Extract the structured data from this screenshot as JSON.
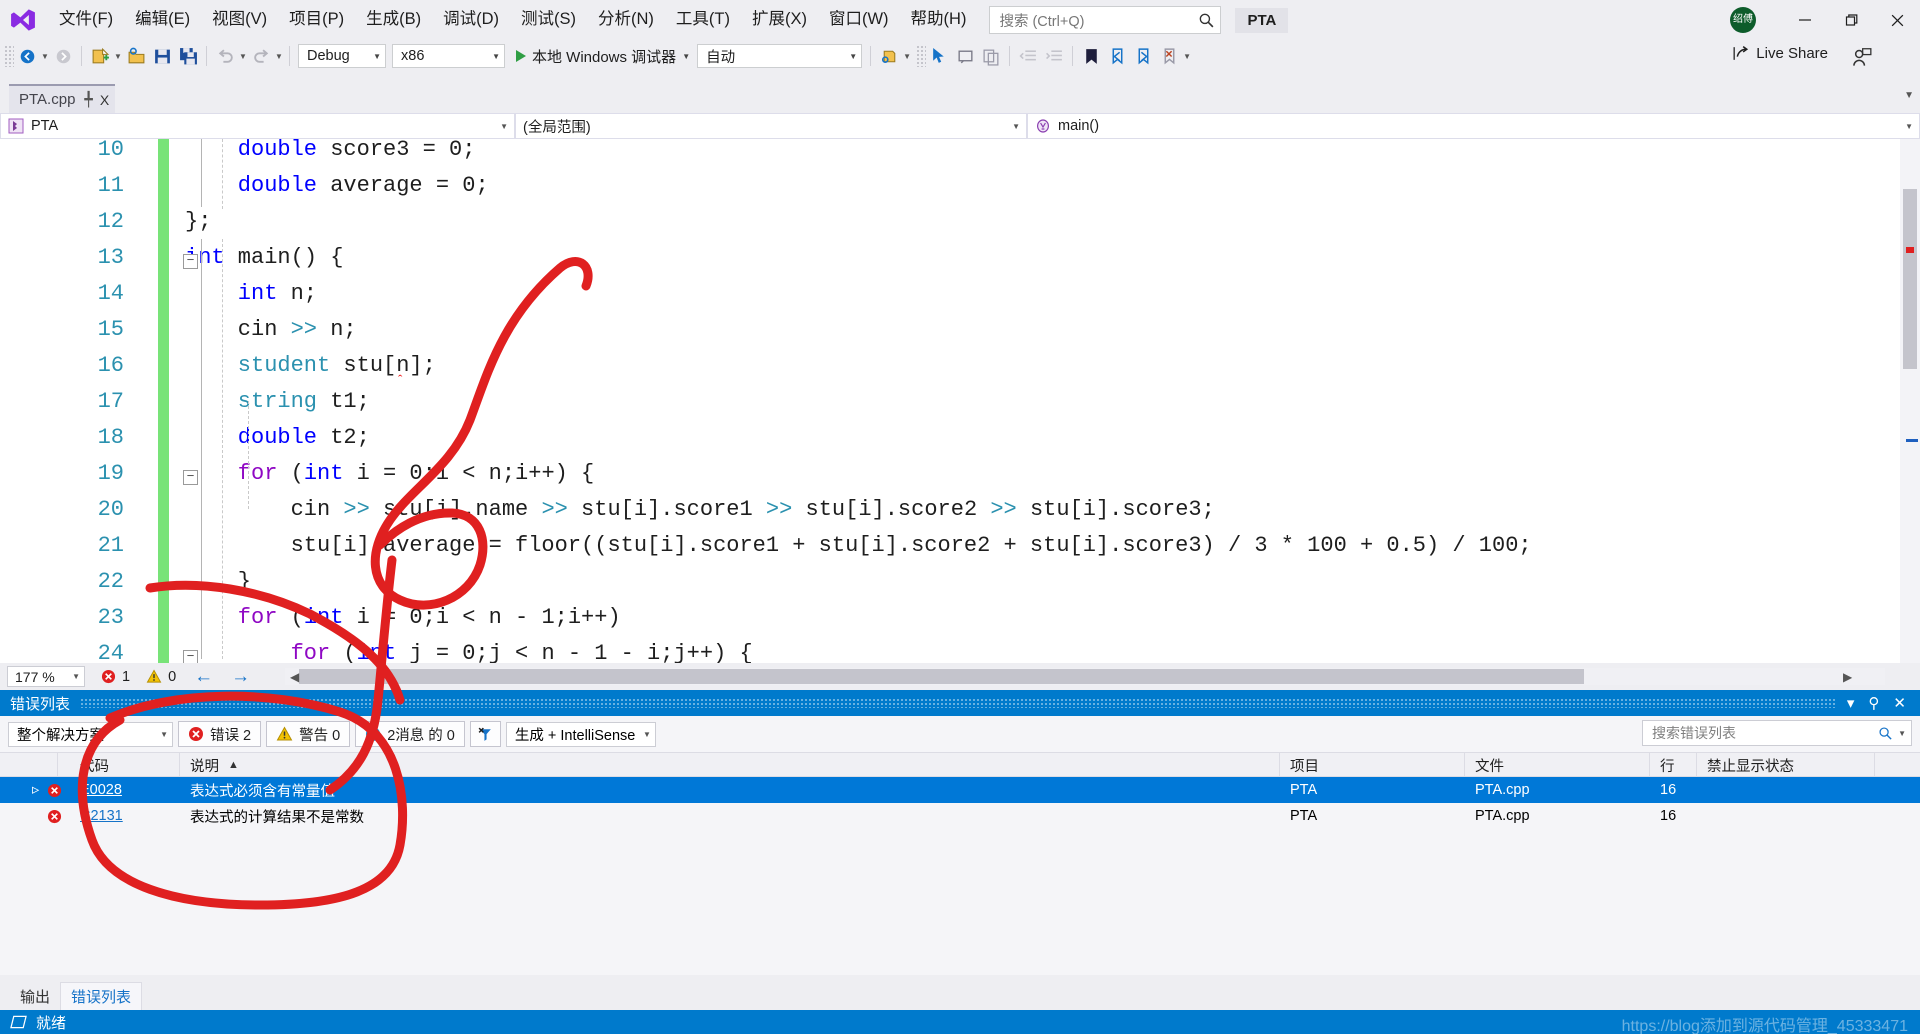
{
  "app": {
    "title_project": "PTA",
    "menus": [
      "文件(F)",
      "编辑(E)",
      "视图(V)",
      "项目(P)",
      "生成(B)",
      "调试(D)",
      "测试(S)",
      "分析(N)",
      "工具(T)",
      "扩展(X)",
      "窗口(W)",
      "帮助(H)"
    ],
    "search_placeholder": "搜索 (Ctrl+Q)",
    "avatar_text": "绍傅",
    "window_buttons": {
      "minimize": "—",
      "maximize": "❐",
      "close": "✕"
    }
  },
  "toolbar": {
    "config": "Debug",
    "platform": "x86",
    "run_label": "本地 Windows 调试器",
    "auto_label": "自动",
    "live_share": "Live Share"
  },
  "tabs": {
    "document": "PTA.cpp",
    "pin_glyph": "╇",
    "close_glyph": "X"
  },
  "navbar": {
    "project": "PTA",
    "scope": "(全局范围)",
    "member": "main()"
  },
  "editor": {
    "zoom": "177 %",
    "error_count": "1",
    "warning_count": "0",
    "lines": [
      {
        "num": "10",
        "indent": 4,
        "tokens": [
          {
            "t": "double",
            "c": "kw"
          },
          {
            "t": " score3 = 0;",
            "c": "op"
          }
        ]
      },
      {
        "num": "11",
        "indent": 4,
        "tokens": [
          {
            "t": "double",
            "c": "kw"
          },
          {
            "t": " average = 0;",
            "c": "op"
          }
        ]
      },
      {
        "num": "12",
        "indent": 0,
        "tokens": [
          {
            "t": "};",
            "c": "op"
          }
        ]
      },
      {
        "num": "13",
        "indent": 0,
        "tokens": [
          {
            "t": "int",
            "c": "kw"
          },
          {
            "t": " main() {",
            "c": "op"
          }
        ]
      },
      {
        "num": "14",
        "indent": 4,
        "tokens": [
          {
            "t": "int",
            "c": "kw"
          },
          {
            "t": " n;",
            "c": "op"
          }
        ]
      },
      {
        "num": "15",
        "indent": 4,
        "tokens": [
          {
            "t": "cin ",
            "c": "op"
          },
          {
            "t": ">>",
            "c": "typ"
          },
          {
            "t": " n;",
            "c": "op"
          }
        ]
      },
      {
        "num": "16",
        "indent": 4,
        "tokens": [
          {
            "t": "student",
            "c": "typ"
          },
          {
            "t": " stu[n];",
            "c": "op"
          }
        ]
      },
      {
        "num": "17",
        "indent": 4,
        "tokens": [
          {
            "t": "string",
            "c": "typ"
          },
          {
            "t": " t1;",
            "c": "op"
          }
        ]
      },
      {
        "num": "18",
        "indent": 4,
        "tokens": [
          {
            "t": "double",
            "c": "kw"
          },
          {
            "t": " t2;",
            "c": "op"
          }
        ]
      },
      {
        "num": "19",
        "indent": 4,
        "tokens": [
          {
            "t": "for",
            "c": "kw2"
          },
          {
            "t": " (",
            "c": "op"
          },
          {
            "t": "int",
            "c": "kw"
          },
          {
            "t": " i = 0;i < n;i++) {",
            "c": "op"
          }
        ]
      },
      {
        "num": "20",
        "indent": 8,
        "tokens": [
          {
            "t": "cin ",
            "c": "op"
          },
          {
            "t": ">>",
            "c": "typ"
          },
          {
            "t": " stu[i].name ",
            "c": "op"
          },
          {
            "t": ">>",
            "c": "typ"
          },
          {
            "t": " stu[i].score1 ",
            "c": "op"
          },
          {
            "t": ">>",
            "c": "typ"
          },
          {
            "t": " stu[i].score2 ",
            "c": "op"
          },
          {
            "t": ">>",
            "c": "typ"
          },
          {
            "t": " stu[i].score3;",
            "c": "op"
          }
        ]
      },
      {
        "num": "21",
        "indent": 8,
        "tokens": [
          {
            "t": "stu[i].average = floor((stu[i].score1 + stu[i].score2 + stu[i].score3) / 3 * 100 + 0.5) / 100;",
            "c": "op"
          }
        ]
      },
      {
        "num": "22",
        "indent": 4,
        "tokens": [
          {
            "t": "}",
            "c": "op"
          }
        ]
      },
      {
        "num": "23",
        "indent": 4,
        "tokens": [
          {
            "t": "for",
            "c": "kw2"
          },
          {
            "t": " (",
            "c": "op"
          },
          {
            "t": "int",
            "c": "kw"
          },
          {
            "t": " i = 0;i < n - 1;i++)",
            "c": "op"
          }
        ]
      },
      {
        "num": "24",
        "indent": 8,
        "tokens": [
          {
            "t": "for",
            "c": "kw2"
          },
          {
            "t": " (",
            "c": "op"
          },
          {
            "t": "int",
            "c": "kw"
          },
          {
            "t": " j = 0;j < n - 1 - i;j++) {",
            "c": "op"
          }
        ]
      }
    ]
  },
  "error_list": {
    "panel_title": "错误列表",
    "scope_filter": "整个解决方案",
    "errors_label": "错误 2",
    "warnings_label": "警告 0",
    "messages_label": "2消息 的 0",
    "build_filter": "生成 + IntelliSense",
    "search_placeholder": "搜索错误列表",
    "columns": [
      "代码",
      "说明",
      "项目",
      "文件",
      "行",
      "禁止显示状态"
    ],
    "sort_glyph": "▲",
    "rows": [
      {
        "code": "E0028",
        "description": "表达式必须含有常量值",
        "project": "PTA",
        "file": "PTA.cpp",
        "line": "16",
        "suppression": "",
        "severity": "error",
        "selected": true
      },
      {
        "code": "C2131",
        "description": "表达式的计算结果不是常数",
        "project": "PTA",
        "file": "PTA.cpp",
        "line": "16",
        "suppression": "",
        "severity": "error",
        "selected": false
      }
    ]
  },
  "bottom_tabs": [
    {
      "label": "输出",
      "active": false
    },
    {
      "label": "错误列表",
      "active": true
    }
  ],
  "statusbar": {
    "ready": "就绪",
    "watermark": "https://blog添加到源代码管理_45333471"
  },
  "colors": {
    "accent_blue": "#007acc",
    "selection_blue": "#0078d7",
    "change_bar_green": "#78e378",
    "annotation_red": "#e02020",
    "keyword_blue": "#0000ff",
    "type_teal": "#2b91af",
    "keyword_purple": "#8f08c4"
  }
}
